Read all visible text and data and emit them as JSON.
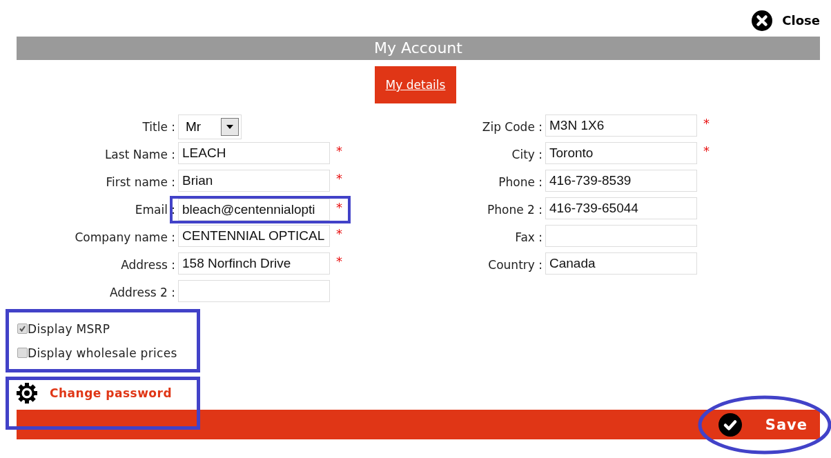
{
  "close": {
    "label": "Close"
  },
  "header": {
    "title": "My Account"
  },
  "tabs": [
    {
      "label": "My details",
      "selected": true
    }
  ],
  "left_fields": [
    {
      "kind": "select",
      "label": "Title :",
      "value": "Mr",
      "required": false,
      "highlighted": false
    },
    {
      "kind": "text",
      "label": "Last Name :",
      "value": "LEACH",
      "required": true,
      "highlighted": false
    },
    {
      "kind": "text",
      "label": "First name :",
      "value": "Brian",
      "required": true,
      "highlighted": false
    },
    {
      "kind": "text",
      "label": "Email :",
      "value": "bleach@centennialopti",
      "required": true,
      "highlighted": true
    },
    {
      "kind": "text",
      "label": "Company name :",
      "value": "CENTENNIAL OPTICAL",
      "required": true,
      "highlighted": false
    },
    {
      "kind": "text",
      "label": "Address :",
      "value": "158 Norfinch Drive",
      "required": true,
      "highlighted": false
    },
    {
      "kind": "text",
      "label": "Address 2 :",
      "required": false,
      "highlighted": false
    }
  ],
  "right_fields": [
    {
      "kind": "text",
      "label": "Zip Code :",
      "value": "M3N 1X6",
      "required": true,
      "highlighted": false
    },
    {
      "kind": "text",
      "label": "City :",
      "value": "Toronto",
      "required": true,
      "highlighted": false
    },
    {
      "kind": "text",
      "label": "Phone :",
      "value": "416-739-8539",
      "required": false,
      "highlighted": false
    },
    {
      "kind": "text",
      "label": "Phone 2 :",
      "value": "416-739-65044",
      "required": false,
      "highlighted": false
    },
    {
      "kind": "text",
      "label": "Fax :",
      "required": false,
      "highlighted": false
    },
    {
      "kind": "text",
      "label": "Country :",
      "value": "Canada",
      "required": false,
      "highlighted": false
    }
  ],
  "required_mark": "*",
  "options": {
    "highlighted": true,
    "items": [
      {
        "label": "Display MSRP",
        "checked": true
      },
      {
        "label": "Display wholesale prices",
        "checked": false
      }
    ]
  },
  "change_password": {
    "label": "Change password",
    "highlighted": true
  },
  "save": {
    "label": "Save",
    "highlighted": true
  }
}
